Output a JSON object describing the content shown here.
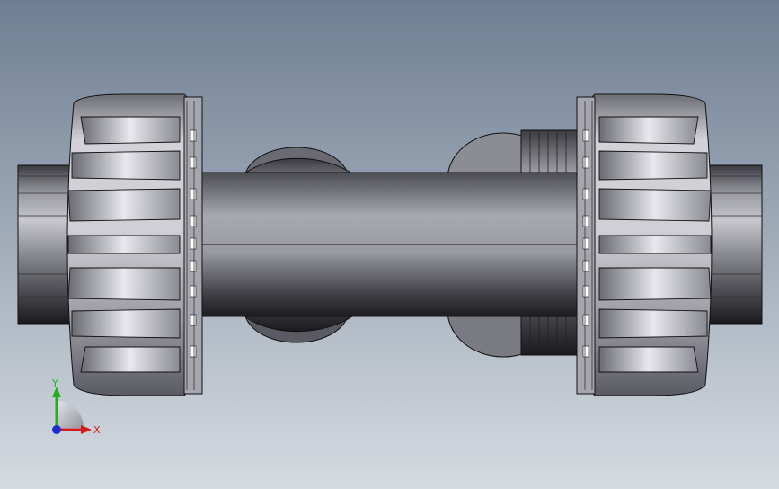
{
  "viewport": {
    "background_top": "#6e7e92",
    "background_bottom": "#d6dbe1"
  },
  "triad": {
    "x_label": "X",
    "y_label": "Y",
    "x_color": "#d01c1c",
    "y_color": "#22b022",
    "z_color": "#1c2ed0"
  },
  "model": {
    "body_color": "#8f8f96",
    "nut_color": "#b7b7bd",
    "edge_color": "#111111"
  }
}
